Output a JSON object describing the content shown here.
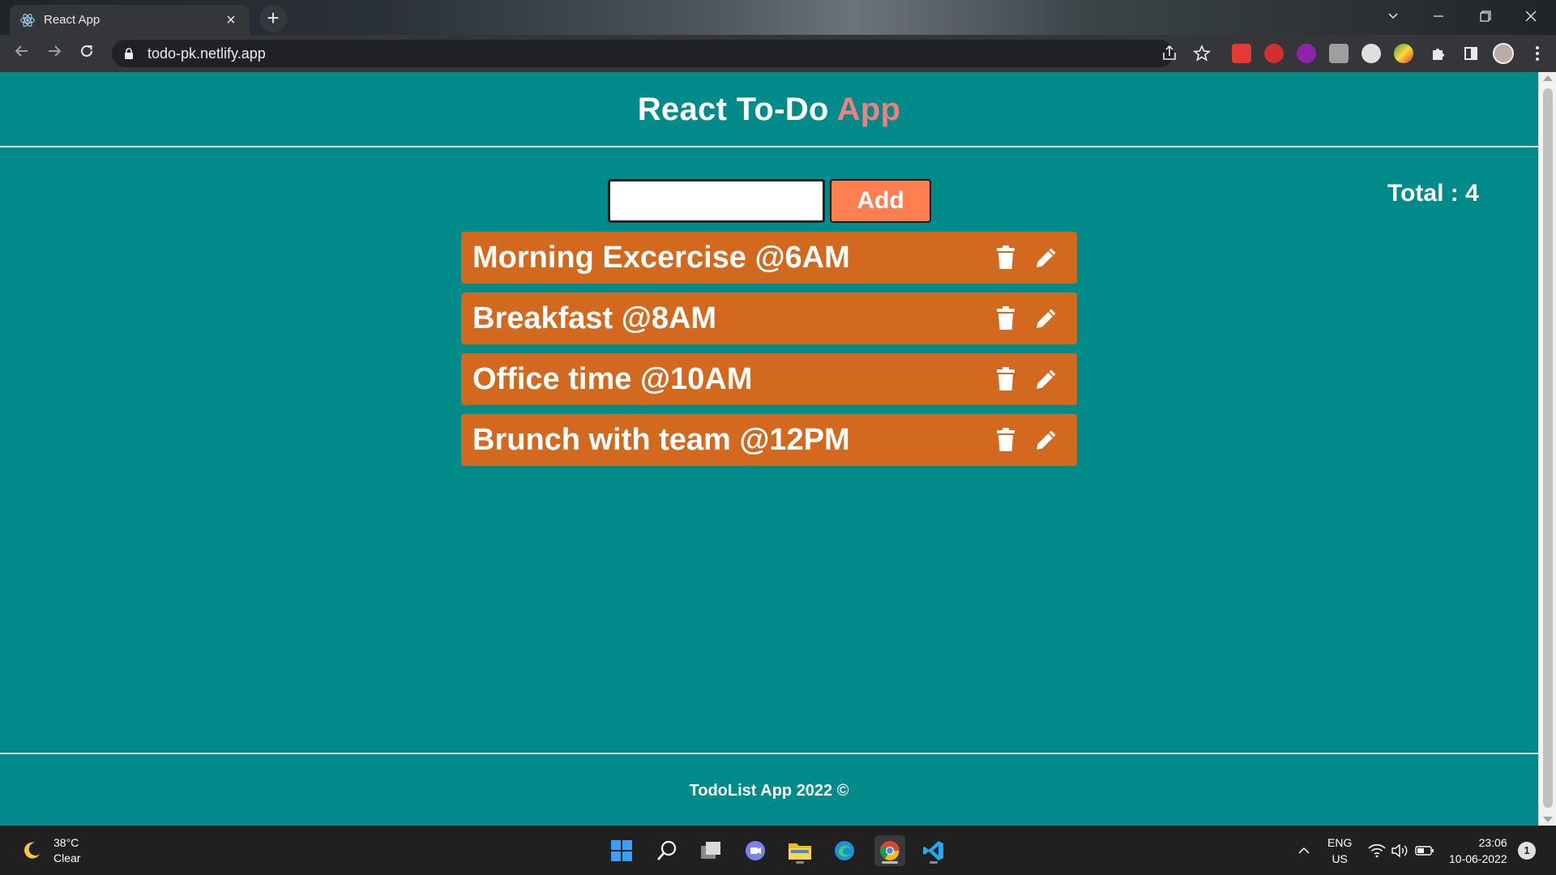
{
  "browser": {
    "tab_title": "React App",
    "url": "todo-pk.netlify.app"
  },
  "app": {
    "title_main": "React To-Do",
    "title_accent": "App",
    "add_label": "Add",
    "input_value": "",
    "total_label": "Total : 4",
    "todos": [
      {
        "text": "Morning Excercise @6AM"
      },
      {
        "text": "Breakfast @8AM"
      },
      {
        "text": "Office time @10AM"
      },
      {
        "text": "Brunch with team @12PM"
      }
    ],
    "footer": "TodoList App 2022 ©"
  },
  "colors": {
    "page_bg": "#008b8b",
    "accent": "#f08080",
    "item_bg": "#d2691e",
    "button_bg": "#ff7f50"
  },
  "taskbar": {
    "temperature": "38°C",
    "weather": "Clear",
    "lang_top": "ENG",
    "lang_bottom": "US",
    "time": "23:06",
    "date": "10-06-2022",
    "notifications": "1"
  }
}
